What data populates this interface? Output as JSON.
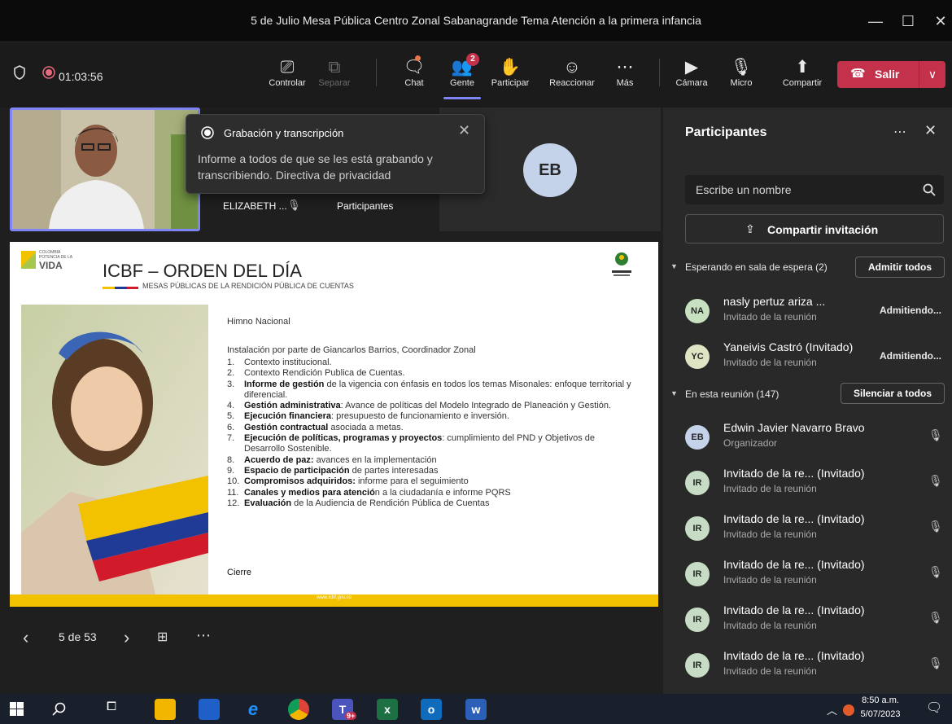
{
  "window": {
    "title": "5 de Julio Mesa Pública Centro Zonal Sabanagrande Tema Atención a la primera infancia",
    "minimize": "—",
    "maximize": "☐",
    "close": "✕"
  },
  "toolbar": {
    "timer": "01:03:56",
    "buttons": [
      {
        "label": "Controlar",
        "icon": "present-control-icon"
      },
      {
        "label": "Separar",
        "icon": "popout-icon"
      },
      {
        "label": "Chat",
        "icon": "chat-icon"
      },
      {
        "label": "Gente",
        "icon": "people-icon",
        "badge": "2"
      },
      {
        "label": "Participar",
        "icon": "raise-hand-icon"
      },
      {
        "label": "Reaccionar",
        "icon": "smiley-icon"
      },
      {
        "label": "Más",
        "icon": "more-icon"
      },
      {
        "label": "Cámara",
        "icon": "camera-off-icon"
      },
      {
        "label": "Micro",
        "icon": "mic-off-icon"
      },
      {
        "label": "Compartir",
        "icon": "share-icon"
      }
    ],
    "leave_label": "Salir"
  },
  "tiles": {
    "self_name": "ELIZABETH ...",
    "participants_link": "Participantes",
    "eb_initials": "EB"
  },
  "toast": {
    "title": "Grabación y transcripción",
    "body": "Informe a todos de que se les está grabando y transcribiendo. Directiva de privacidad"
  },
  "slide": {
    "logo_small_1": "COLOMBIA",
    "logo_small_2": "POTENCIA DE LA",
    "logo_big": "VIDA",
    "title": "ICBF – ORDEN DEL DÍA",
    "subtitle": "MESAS PÚBLICAS DE LA RENDICIÓN PÚBLICA DE CUENTAS",
    "intro1": "Himno Nacional",
    "intro2": "Instalación por parte de Giancarlos Barrios, Coordinador Zonal",
    "items": [
      {
        "n": "1.",
        "b": "",
        "t": "Contexto institucional."
      },
      {
        "n": "2.",
        "b": "",
        "t": "Contexto Rendición Publica de Cuentas."
      },
      {
        "n": "3.",
        "b": "Informe de gestión",
        "t": " de la vigencia con énfasis en todos los temas Misonales: enfoque territorial y diferencial."
      },
      {
        "n": "4.",
        "b": "Gestión administrativa",
        "t": ": Avance de políticas del Modelo Integrado de Planeación y Gestión."
      },
      {
        "n": "5.",
        "b": "Ejecución financiera",
        "t": ": presupuesto de funcionamiento e inversión."
      },
      {
        "n": "6.",
        "b": "Gestión contractual",
        "t": " asociada a metas."
      },
      {
        "n": "7.",
        "b": "Ejecución de políticas, programas y proyectos",
        "t": ": cumplimiento del PND y Objetivos de Desarrollo Sostenible."
      },
      {
        "n": "8.",
        "b": "Acuerdo de paz:",
        "t": " avances en la implementación"
      },
      {
        "n": "9.",
        "b": "Espacio de participación",
        "t": " de partes interesadas"
      },
      {
        "n": "10.",
        "b": "Compromisos adquiridos:",
        "t": " informe para el seguimiento"
      },
      {
        "n": "11.",
        "b": "Canales y medios para atenció",
        "t": "n a la ciudadanía e informe PQRS"
      },
      {
        "n": "12.",
        "b": "Evaluación",
        "t": " de la Audiencia de Rendición Pública de Cuentas"
      }
    ],
    "closing": "Cierre",
    "footer_url": "www.icbf.gov.co"
  },
  "slide_nav": {
    "page": "5 de 53"
  },
  "panel": {
    "title": "Participantes",
    "search_placeholder": "Escribe un nombre",
    "share_invite": "Compartir invitación",
    "waiting_header": "Esperando en sala de espera (2)",
    "admit_all": "Admitir todos",
    "waiting": [
      {
        "initials": "NA",
        "name": "nasly pertuz ariza ...",
        "role": "Invitado de la reunión",
        "status": "Admitiendo...",
        "color": "#c7e0c0"
      },
      {
        "initials": "YC",
        "name": "Yaneivis Castró (Invitado)",
        "role": "Invitado de la reunión",
        "status": "Admitiendo...",
        "color": "#dfe5c4"
      }
    ],
    "in_meeting_header": "En esta reunión (147)",
    "mute_all": "Silenciar a todos",
    "members": [
      {
        "initials": "EB",
        "name": "Edwin Javier Navarro Bravo",
        "role": "Organizador",
        "color": "#c5d3ea"
      },
      {
        "initials": "IR",
        "name": "Invitado de la re... (Invitado)",
        "role": "Invitado de la reunión",
        "color": "#c7dcc4"
      },
      {
        "initials": "IR",
        "name": "Invitado de la re... (Invitado)",
        "role": "Invitado de la reunión",
        "color": "#c7dcc4"
      },
      {
        "initials": "IR",
        "name": "Invitado de la re... (Invitado)",
        "role": "Invitado de la reunión",
        "color": "#c7dcc4"
      },
      {
        "initials": "IR",
        "name": "Invitado de la re... (Invitado)",
        "role": "Invitado de la reunión",
        "color": "#c7dcc4"
      },
      {
        "initials": "IR",
        "name": "Invitado de la re... (Invitado)",
        "role": "Invitado de la reunión",
        "color": "#c7dcc4"
      }
    ]
  },
  "taskbar": {
    "time": "8:50 a.m.",
    "date": "5/07/2023",
    "teams_badge": "9+"
  }
}
